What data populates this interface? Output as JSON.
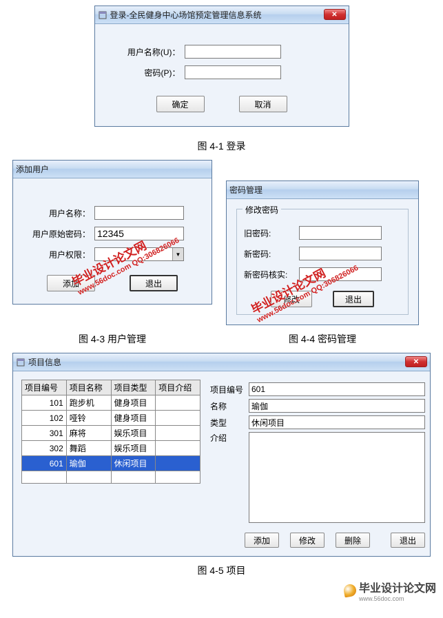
{
  "login": {
    "title": "登录-全民健身中心场馆预定管理信息系统",
    "username_label": "用户名称(U)：",
    "password_label": "密码(P)：",
    "ok_label": "确定",
    "cancel_label": "取消",
    "caption": "图 4-1  登录"
  },
  "adduser": {
    "title": "添加用户",
    "username_label": "用户名称：",
    "initpwd_label": "用户原始密码：",
    "initpwd_value": "12345",
    "priv_label": "用户权限：",
    "add_label": "添加",
    "exit_label": "退出",
    "caption": "图 4-3 用户管理"
  },
  "pwdmgr": {
    "title": "密码管理",
    "group_title": "修改密码",
    "oldpwd_label": "旧密码:",
    "newpwd_label": "新密码:",
    "confirmpwd_label": "新密码核实:",
    "modify_label": "修改",
    "exit_label": "退出",
    "caption": "图 4-4 密码管理"
  },
  "project": {
    "title": "项目信息",
    "cols": [
      "项目编号",
      "项目名称",
      "项目类型",
      "项目介绍"
    ],
    "rows": [
      {
        "id": "101",
        "name": "跑步机",
        "type": "健身项目",
        "intro": ""
      },
      {
        "id": "102",
        "name": "哑铃",
        "type": "健身项目",
        "intro": ""
      },
      {
        "id": "301",
        "name": "麻将",
        "type": "娱乐项目",
        "intro": ""
      },
      {
        "id": "302",
        "name": "舞蹈",
        "type": "娱乐项目",
        "intro": ""
      },
      {
        "id": "601",
        "name": "瑜伽",
        "type": "休闲项目",
        "intro": ""
      }
    ],
    "detail_id_label": "项目编号",
    "detail_name_label": "名称",
    "detail_type_label": "类型",
    "detail_intro_label": "介绍",
    "detail_id_value": "601",
    "detail_name_value": "瑜伽",
    "detail_type_value": "休闲项目",
    "detail_intro_value": "",
    "add_label": "添加",
    "modify_label": "修改",
    "delete_label": "删除",
    "exit_label": "退出",
    "caption": "图 4-5 项目"
  },
  "watermark": {
    "line1": "毕业设计论文网",
    "line2": "www.56doc.com    QQ:306826066"
  },
  "footer": {
    "text": "毕业设计论文网",
    "url": "www.56doc.com"
  }
}
